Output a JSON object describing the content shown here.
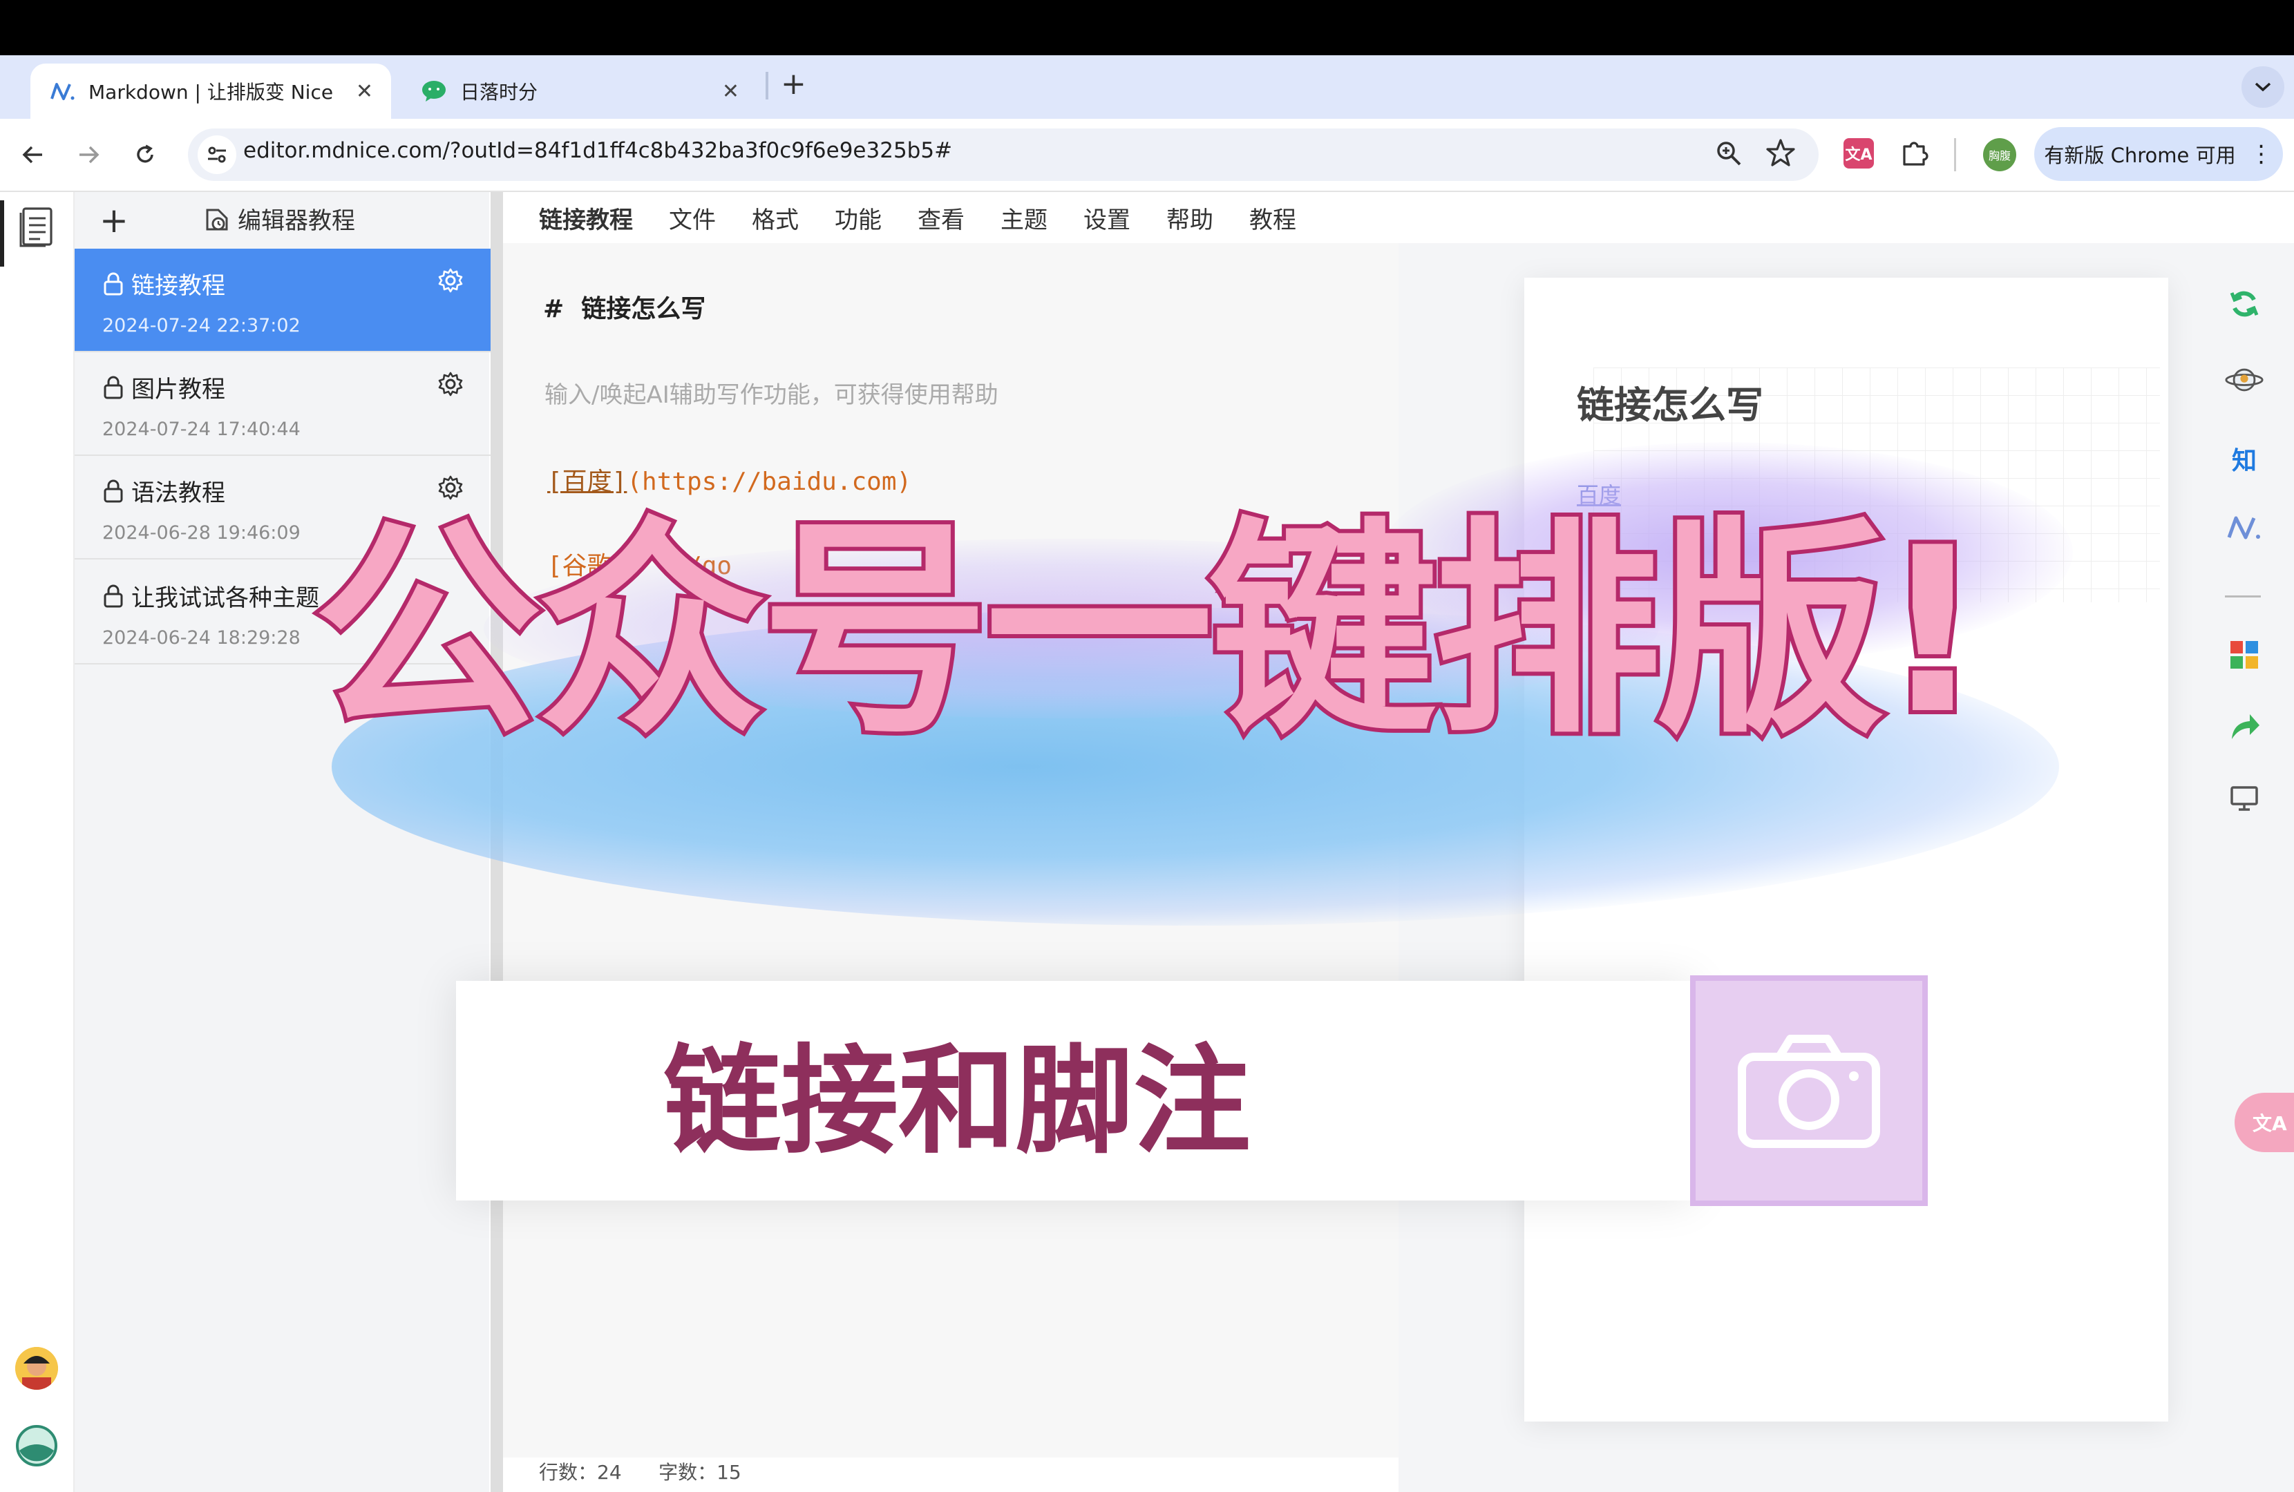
{
  "browser": {
    "tabs": [
      {
        "label": "Markdown | 让排版变 Nice",
        "close": "✕"
      },
      {
        "label": "日落时分",
        "close": "✕"
      }
    ],
    "new_tab": "+",
    "tab_menu": "⌄",
    "url": "editor.mdnice.com/?outId=84f1d1ff4c8b432ba3f0c9f6e9e325b5#",
    "profile_label": "胸腹",
    "update_button": "有新版 Chrome 可用",
    "more": "⋮"
  },
  "sidebar": {
    "add": "+",
    "folder_title": "编辑器教程",
    "files": [
      {
        "name": "链接教程",
        "date": "2024-07-24 22:37:02"
      },
      {
        "name": "图片教程",
        "date": "2024-07-24 17:40:44"
      },
      {
        "name": "语法教程",
        "date": "2024-06-28 19:46:09"
      },
      {
        "name": "让我试试各种主题",
        "date": "2024-06-24 18:29:28"
      }
    ]
  },
  "menu": [
    "链接教程",
    "文件",
    "格式",
    "功能",
    "查看",
    "主题",
    "设置",
    "帮助",
    "教程"
  ],
  "editor": {
    "heading_mark": "#",
    "heading": "链接怎么写",
    "placeholder": "输入/唤起AI辅助写作功能，可获得使用帮助",
    "link_text": "[百度]",
    "link_url": "(https://baidu.com)",
    "partial_line_a": "[谷歌]",
    "partial_line_b": "/go"
  },
  "preview": {
    "title": "链接怎么写",
    "link": "百度"
  },
  "right_toolbar": {
    "zhihu": "知",
    "nice": "N"
  },
  "status": {
    "lines_label": "行数：",
    "lines": "24",
    "chars_label": "字数：",
    "chars": "15"
  },
  "overlay": {
    "title": "公众号一键排版!",
    "subtitle": "链接和脚注"
  },
  "colors": {
    "accent": "#4a8df1",
    "title_fill": "#f7a7c4",
    "title_stroke": "#b5296a",
    "subtitle": "#8e2f5c"
  }
}
